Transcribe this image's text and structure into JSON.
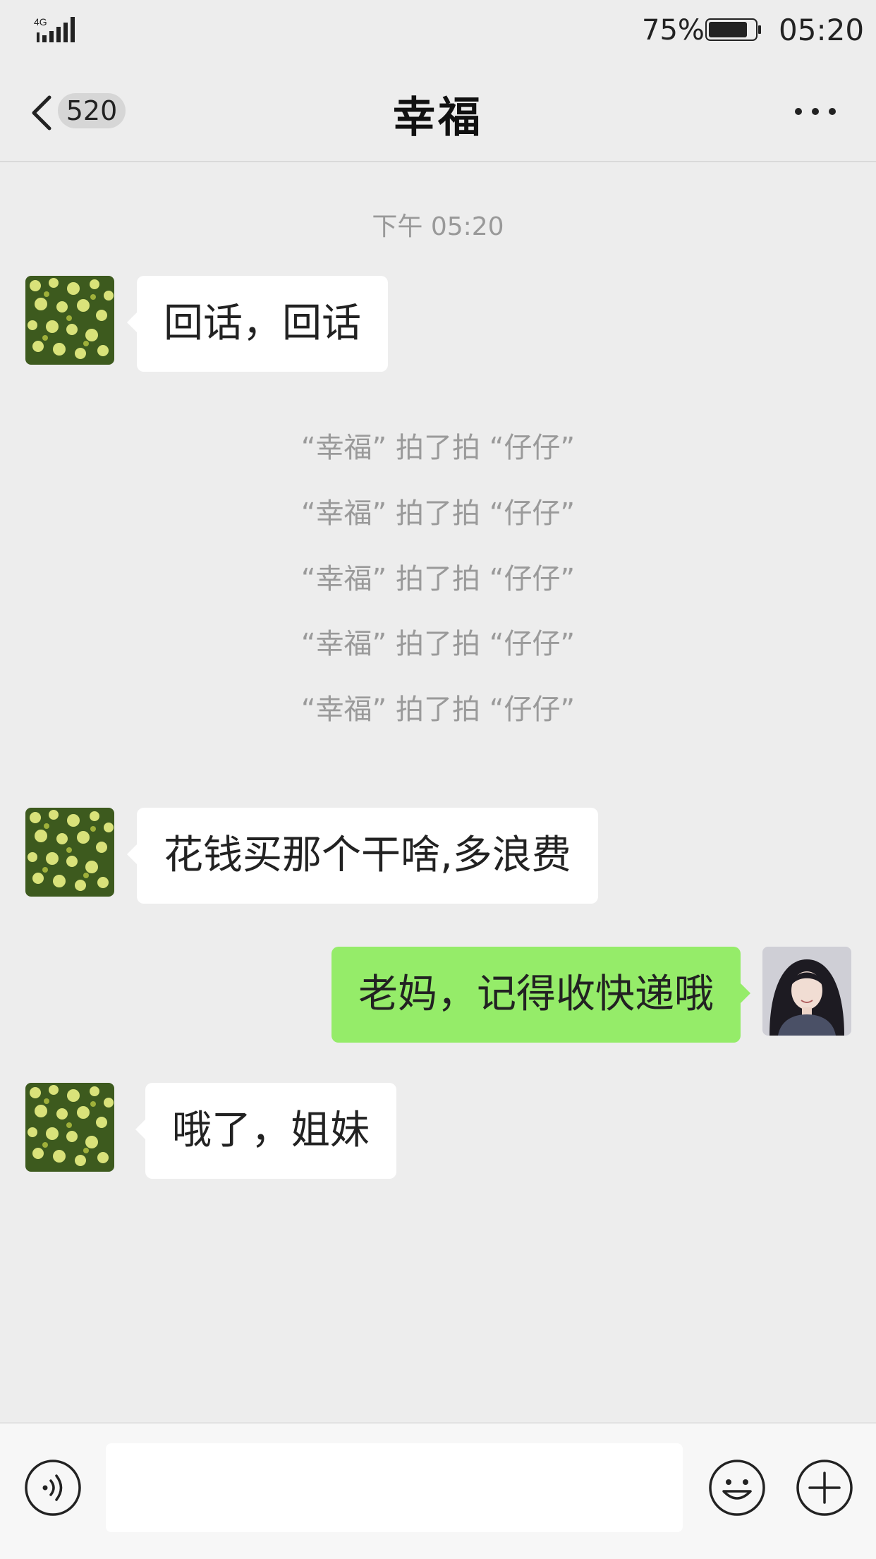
{
  "status_bar": {
    "network": "4G",
    "battery_percent": "75%",
    "time": "05:20"
  },
  "header": {
    "unread_count": "520",
    "title": "幸福"
  },
  "chat": {
    "timestamp": "下午 05:20",
    "messages": [
      {
        "side": "left",
        "text": "回话，回话"
      },
      {
        "side": "left",
        "text": "花钱买那个干啥,多浪费"
      },
      {
        "side": "right",
        "text": "老妈，记得收快递哦"
      },
      {
        "side": "left",
        "text": "哦了，姐妹"
      }
    ],
    "system_notices": [
      "“幸福” 拍了拍 “仔仔”",
      "“幸福” 拍了拍 “仔仔”",
      "“幸福” 拍了拍 “仔仔”",
      "“幸福” 拍了拍 “仔仔”",
      "“幸福” 拍了拍 “仔仔”"
    ]
  },
  "input_bar": {
    "text_value": ""
  },
  "colors": {
    "sent_bubble": "#95ec69",
    "received_bubble": "#ffffff",
    "background": "#ededed"
  }
}
